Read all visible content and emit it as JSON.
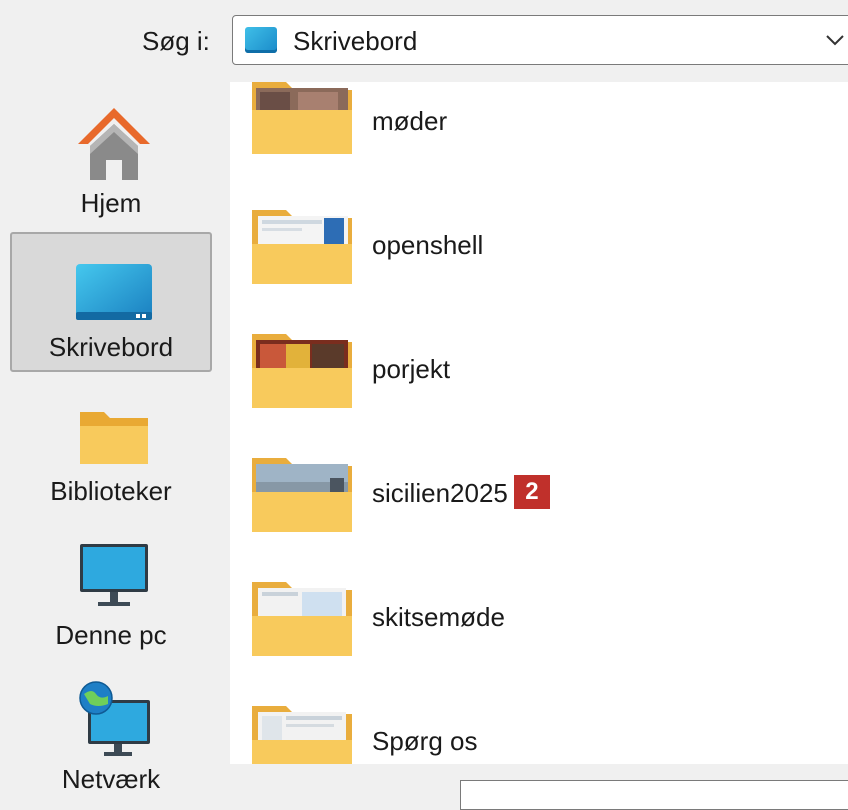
{
  "toolbar": {
    "look_in_label": "Søg i:",
    "look_in_value": "Skrivebord",
    "dropdown_icon": "chevron-down-icon"
  },
  "sidebar": {
    "items": [
      {
        "label": "Hjem",
        "icon": "home-icon",
        "selected": false
      },
      {
        "label": "Skrivebord",
        "icon": "desktop-icon",
        "selected": true
      },
      {
        "label": "Biblioteker",
        "icon": "folder-icon",
        "selected": false
      },
      {
        "label": "Denne pc",
        "icon": "monitor-icon",
        "selected": false
      },
      {
        "label": "Netværk",
        "icon": "network-icon",
        "selected": false
      }
    ]
  },
  "files": [
    {
      "name": "møder",
      "icon": "folder-icon"
    },
    {
      "name": "openshell",
      "icon": "folder-icon"
    },
    {
      "name": "porjekt",
      "icon": "folder-icon"
    },
    {
      "name": "sicilien2025",
      "icon": "folder-icon",
      "badge": "2"
    },
    {
      "name": "skitsemøde",
      "icon": "folder-icon"
    },
    {
      "name": "Spørg os",
      "icon": "folder-icon"
    }
  ],
  "colors": {
    "badge": "#c0302b",
    "folder": "#f7c85a",
    "accent": "#1a8ac9"
  }
}
